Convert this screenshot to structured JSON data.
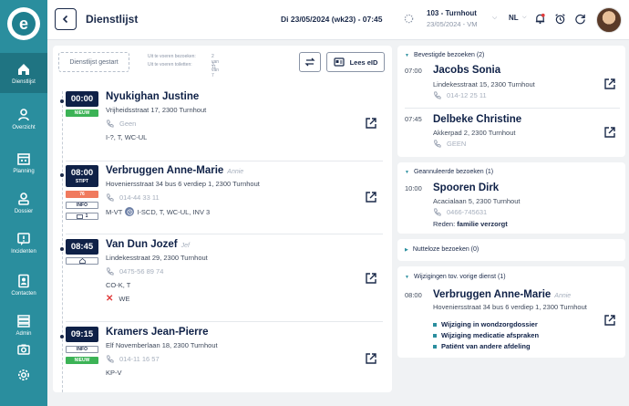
{
  "sidebar": {
    "items": [
      {
        "label": "Dienstlijst",
        "icon": "home-icon"
      },
      {
        "label": "Overzicht",
        "icon": "people-icon"
      },
      {
        "label": "Planning",
        "icon": "calendar-icon"
      },
      {
        "label": "Dossier",
        "icon": "person-icon"
      },
      {
        "label": "Incidenten",
        "icon": "alert-icon"
      },
      {
        "label": "Contacten",
        "icon": "contacts-icon"
      },
      {
        "label": "Admin",
        "icon": "admin-icon"
      },
      {
        "label": "",
        "icon": "camera-icon"
      },
      {
        "label": "",
        "icon": "gear-icon"
      }
    ]
  },
  "header": {
    "title": "Dienstlijst",
    "date": "Di 23/05/2024 (wk23) - 07:45",
    "shift_title": "103 - Turnhout",
    "shift_sub": "23/05/2024 - VM",
    "language": "NL"
  },
  "toolbar": {
    "started_label": "Dienstlijst gestart",
    "todo_visits_label": "Uit te voeren bezoeken:",
    "todo_visits_value": "2 van 11",
    "todo_toilets_label": "Uit te voeren toiletten:",
    "todo_toilets_value": "3 van 7",
    "eid_label": "Lees eID"
  },
  "visits": [
    {
      "time": "00:00",
      "badges": [
        "NIEUW"
      ],
      "name": "Nyukighan Justine",
      "nick": "",
      "address": "Vrijheidsstraat 17, 2300 Turnhout",
      "phone": "Geen",
      "codes": "I-?, T, WC-UL"
    },
    {
      "time": "08:00",
      "stipt": "STIPT",
      "badges": [
        "76",
        "INFO",
        "1"
      ],
      "name": "Verbruggen Anne-Marie",
      "nick": "Annie",
      "address": "Hoveniersstraat 34 bus 6 verdiep 1, 2300 Turnhout",
      "phone": "014-44 33 11",
      "codes_a": "M-VT",
      "codes_b": "I-SCD, T, WC-UL, INV 3"
    },
    {
      "time": "08:45",
      "badges": [
        ""
      ],
      "name": "Van Dun Jozef",
      "nick": "Jef",
      "address": "Lindekesstraat 29, 2300 Turnhout",
      "phone": "0475-56 89 74",
      "codes": "CO-K, T",
      "extra": "WE"
    },
    {
      "time": "09:15",
      "badges": [
        "INFO",
        "NIEUW"
      ],
      "name": "Kramers Jean-Pierre",
      "nick": "",
      "address": "Elf Novemberlaan 18, 2300 Turnhout",
      "phone": "014-11 16 57",
      "codes": "KP-V"
    }
  ],
  "confirmed": {
    "title": "Bevestigde bezoeken (2)",
    "items": [
      {
        "time": "07:00",
        "name": "Jacobs Sonia",
        "address": "Lindekesstraat 15, 2300 Turnhout",
        "phone": "014-12 25 11"
      },
      {
        "time": "07:45",
        "name": "Delbeke Christine",
        "address": "Akkerpad 2, 2300 Turnhout",
        "phone": "GEEN"
      }
    ]
  },
  "cancelled": {
    "title": "Geannuleerde bezoeken (1)",
    "items": [
      {
        "time": "10:00",
        "name": "Spooren Dirk",
        "address": "Acacialaan 5, 2300 Turnhout",
        "phone": "0466-745631",
        "reason_label": "Reden:",
        "reason": "familie verzorgt"
      }
    ]
  },
  "useless": {
    "title": "Nutteloze bezoeken (0)"
  },
  "changes": {
    "title": "Wijzigingen tov. vorige dienst (1)",
    "time": "08:00",
    "name": "Verbruggen Anne-Marie",
    "nick": "Annie",
    "address": "Hoveniersstraat 34 bus 6 verdiep 1, 2300 Turnhout",
    "list": [
      "Wijziging in wondzorgdossier",
      "Wijziging medicatie afspraken",
      "Patiënt van andere afdeling"
    ]
  },
  "colors": {
    "accent": "#2a8e9e",
    "navy": "#0f2147",
    "new": "#3cb356",
    "score": "#f07a5e"
  }
}
